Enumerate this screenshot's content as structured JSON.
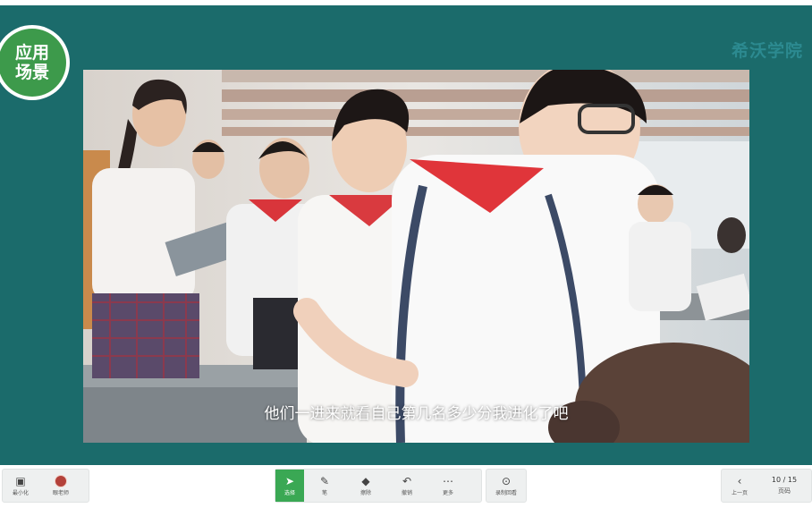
{
  "slide": {
    "badge_line1": "应用",
    "badge_line2": "场景",
    "brand": "希沃学院",
    "subtitle": "他们一进来就看自己第几名多少分我进化了吧"
  },
  "toolbar": {
    "left": [
      {
        "label": "最小化",
        "icon": "minimize-icon"
      },
      {
        "label": "眼老师",
        "icon": "avatar"
      }
    ],
    "center": [
      {
        "label": "选择",
        "icon": "cursor-icon",
        "glyph": "➤",
        "active": true
      },
      {
        "label": "笔",
        "icon": "pen-icon",
        "glyph": "✎",
        "active": false
      },
      {
        "label": "擦除",
        "icon": "eraser-icon",
        "glyph": "◆",
        "active": false
      },
      {
        "label": "撤销",
        "icon": "undo-icon",
        "glyph": "↶",
        "active": false
      },
      {
        "label": "更多",
        "icon": "more-icon",
        "glyph": "⋯",
        "active": false
      }
    ],
    "record": {
      "label": "录制回看",
      "icon": "record-icon",
      "glyph": "⊙"
    },
    "nav": {
      "prev_label": "上一页",
      "prev_glyph": "‹",
      "page": "10 / 15",
      "pages_label": "页码"
    }
  },
  "colors": {
    "slide_bg": "#1b6b6b",
    "badge_green": "#3d9a4b",
    "brand": "#2c8a90",
    "active_tool": "#3aa854"
  }
}
